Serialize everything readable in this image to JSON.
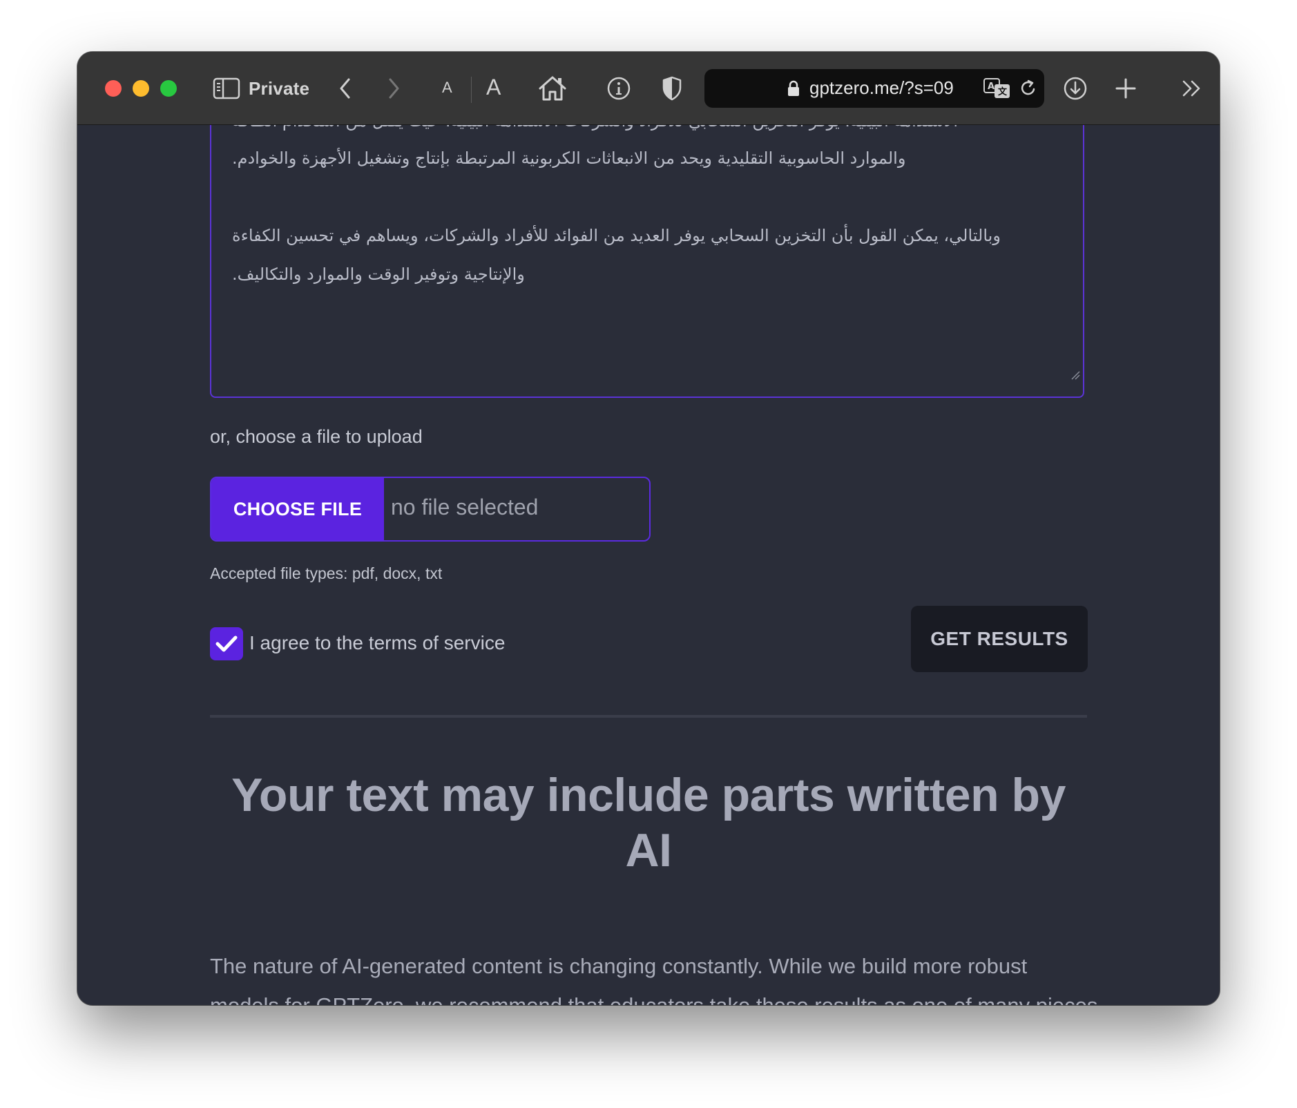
{
  "browser": {
    "private_label": "Private",
    "font_small_label": "A",
    "font_large_label": "A",
    "url": "gptzero.me/?s=09"
  },
  "editor": {
    "partial_line": "الاستدامة البيئية. يوفر التخزين السحابي للأفراد والشركات الاستدامة البيئية، حيث يقلل من استخدام الطاقة",
    "line_1": "والموارد الحاسوبية التقليدية ويحد من الانبعاثات الكربونية المرتبطة بإنتاج وتشغيل الأجهزة والخوادم.",
    "line_2": "وبالتالي، يمكن القول بأن التخزين السحابي يوفر العديد من الفوائد للأفراد والشركات، ويساهم في تحسين الكفاءة",
    "line_3": "والإنتاجية وتوفير الوقت والموارد والتكاليف."
  },
  "upload": {
    "label": "or, choose a file to upload",
    "button_label": "CHOOSE FILE",
    "file_status": "no file selected",
    "accepted_types": "Accepted file types: pdf, docx, txt"
  },
  "terms": {
    "checked": true,
    "label": "I agree to the terms of service"
  },
  "actions": {
    "get_results_label": "GET RESULTS"
  },
  "result": {
    "heading": "Your text may include parts written by AI",
    "body": "The nature of AI-generated content is changing constantly. While we build more robust models for GPTZero, we recommend that educators take these results as one of many pieces in a holistic assessment of student work."
  },
  "colors": {
    "accent": "#5b23e0",
    "page_background": "#2a2d39",
    "button_dark": "#191b23"
  }
}
